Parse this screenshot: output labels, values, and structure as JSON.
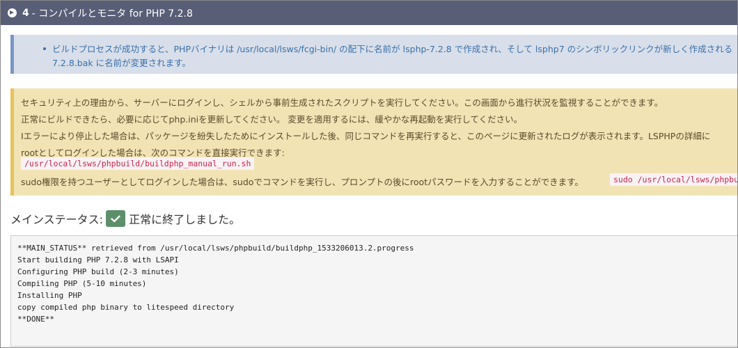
{
  "header": {
    "number": "4",
    "title": " - コンパイルとモニタ for PHP 7.2.8"
  },
  "info": {
    "line1": "ビルドプロセスが成功すると、PHPバイナリは /usr/local/lsws/fcgi-bin/ の配下に名前が lsphp-7.2.8 で作成され、そして lsphp7 のシンボリックリンクが新しく作成される",
    "line2": "7.2.8.bak に名前が変更されます。"
  },
  "warning": {
    "line1": "セキュリティ上の理由から、サーバーにログインし、シェルから事前生成されたスクリプトを実行してください。この画面から進行状況を監視することができます。",
    "line2": "正常にビルドできたら、必要に応じてphp.iniを更新してください。 変更を適用するには、緩やかな再起動を実行してください。",
    "line3": "Iエラーにより停止した場合は、パッケージを紛失したためにインストールした後、同じコマンドを再実行すると、このページに更新されたログが表示されます。LSPHPの詳細に",
    "line4": "rootとしてログインした場合は、次のコマンドを直接実行できます:",
    "command_root": "/usr/local/lsws/phpbuild/buildphp_manual_run.sh",
    "line5": "sudo権限を持つユーザーとしてログインした場合は、sudoでコマンドを実行し、プロンプトの後にrootパスワードを入力することができます。",
    "command_sudo": "sudo /usr/local/lsws/phpbuild/buildphp_manual_run.sh"
  },
  "status": {
    "label": "メインステータス:",
    "value": "正常に終了しました。"
  },
  "log_lines": [
    "**MAIN_STATUS** retrieved from /usr/local/lsws/phpbuild/buildphp_1533206013.2.progress",
    "Start building PHP 7.2.8 with LSAPI",
    "Configuring PHP build (2-3 minutes)",
    "Compiling PHP (5-10 minutes)",
    "Installing PHP",
    "copy compiled php binary to litespeed directory",
    "**DONE**"
  ],
  "colors": {
    "header_bg": "#585e76",
    "info_bg": "#d8dfea",
    "warning_bg": "#f2e3b5",
    "success": "#5c8f6a"
  }
}
